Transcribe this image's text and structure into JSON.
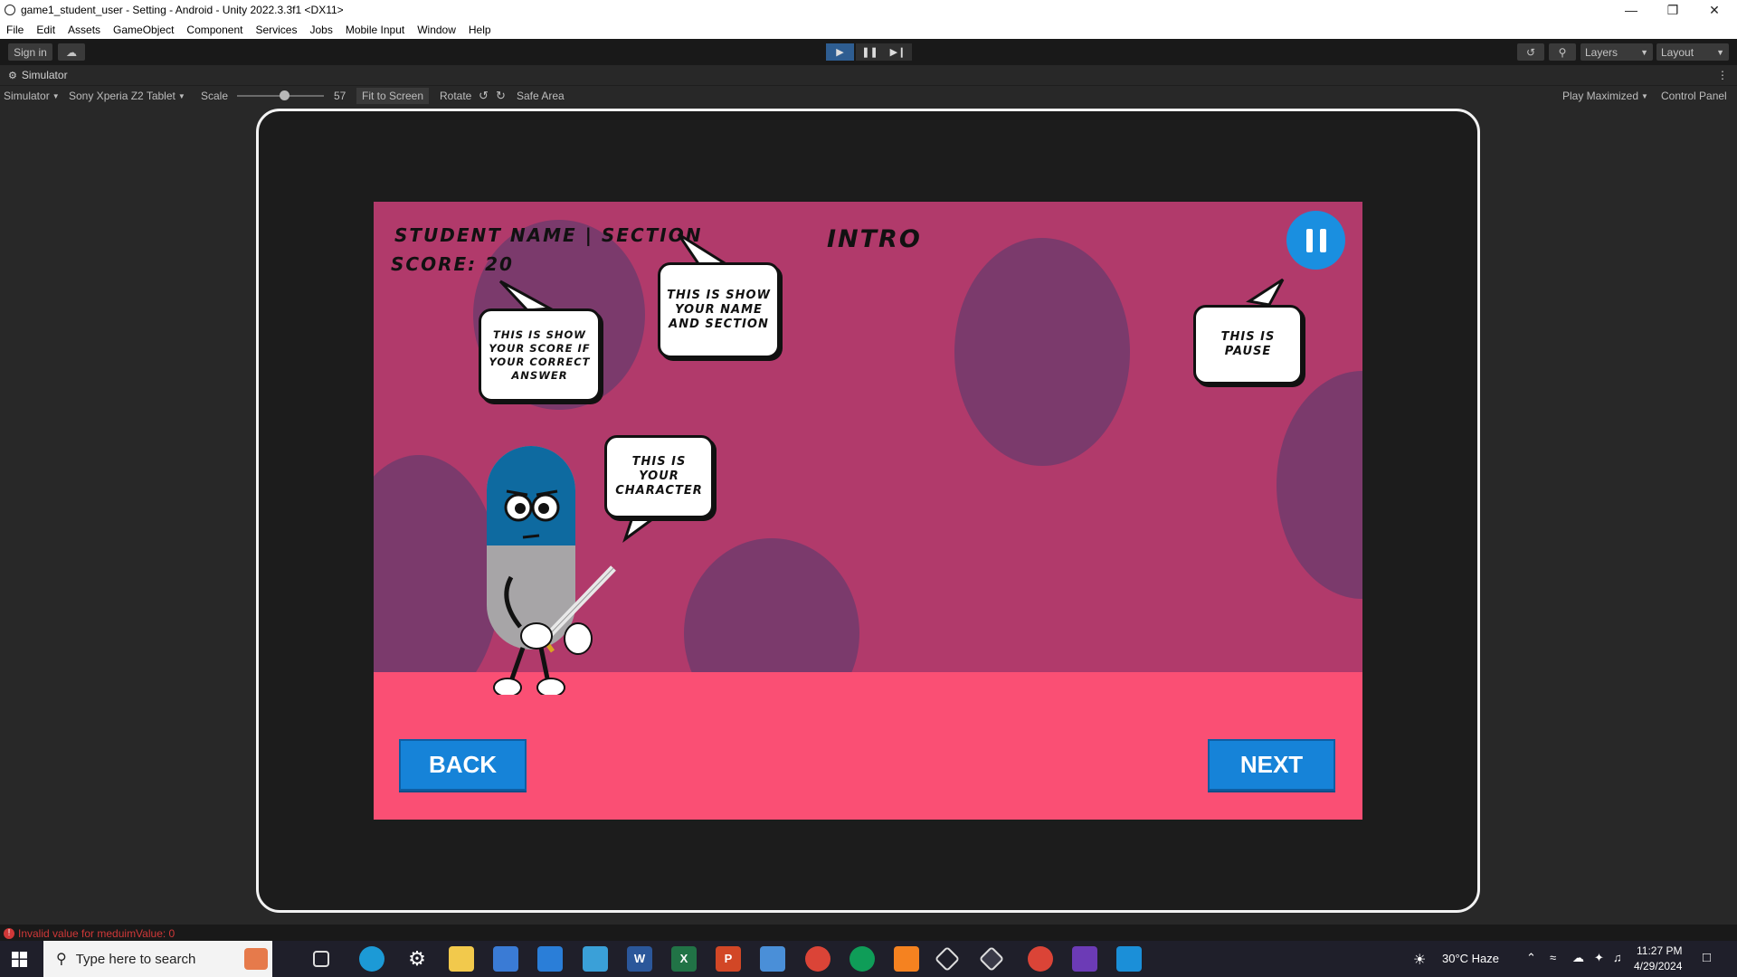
{
  "window": {
    "title": "game1_student_user - Setting - Android - Unity 2022.3.3f1 <DX11>"
  },
  "menu": [
    "File",
    "Edit",
    "Assets",
    "GameObject",
    "Component",
    "Services",
    "Jobs",
    "Mobile Input",
    "Window",
    "Help"
  ],
  "toolbar": {
    "sign_in": "Sign in",
    "layers": "Layers",
    "layout": "Layout"
  },
  "simulator": {
    "tab_title": "Simulator",
    "mode": "Simulator",
    "device": "Sony Xperia Z2 Tablet",
    "scale_label": "Scale",
    "scale_value": "57",
    "fit_to_screen": "Fit to Screen",
    "rotate": "Rotate",
    "safe_area": "Safe Area",
    "play_maximized": "Play Maximized",
    "control_panel": "Control Panel"
  },
  "game": {
    "student_label": "STUDENT NAME | SECTION",
    "score_label": "SCORE: 20",
    "scene_title": "INTRO",
    "bubble_score": "THIS IS SHOW YOUR SCORE IF YOUR CORRECT ANSWER",
    "bubble_name": "THIS IS SHOW YOUR NAME AND SECTION",
    "bubble_pause": "THIS IS PAUSE",
    "bubble_character": "THIS IS YOUR CHARACTER",
    "back_button": "BACK",
    "next_button": "NEXT"
  },
  "status": {
    "message": "Invalid value for meduimValue: 0"
  },
  "taskbar": {
    "search_placeholder": "Type here to search",
    "weather": "30°C  Haze",
    "time": "11:27 PM",
    "date": "4/29/2024"
  },
  "colors": {
    "game_bg": "#b13a6b",
    "ground": "#fa4f74",
    "button": "#1683d8",
    "blob": "#7b3a6c"
  }
}
